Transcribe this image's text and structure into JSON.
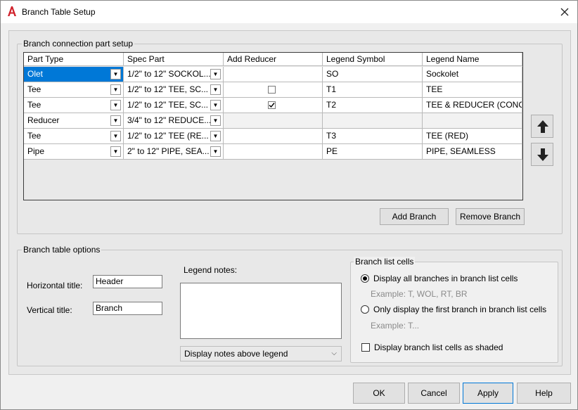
{
  "window": {
    "title": "Branch Table Setup",
    "close_glyph": "✕"
  },
  "connection_group": {
    "legend": "Branch connection part setup",
    "columns": [
      "Part Type",
      "Spec Part",
      "Add Reducer",
      "Legend Symbol",
      "Legend Name"
    ],
    "rows": [
      {
        "part_type": "Olet",
        "spec_part": "1/2\" to 12\"  SOCKOL...",
        "add_reducer": null,
        "legend_symbol": "SO",
        "legend_name": "Sockolet"
      },
      {
        "part_type": "Tee",
        "spec_part": "1/2\" to 12\"  TEE, SC...",
        "add_reducer": false,
        "legend_symbol": "T1",
        "legend_name": "TEE"
      },
      {
        "part_type": "Tee",
        "spec_part": "1/2\" to 12\"  TEE, SC...",
        "add_reducer": true,
        "legend_symbol": "T2",
        "legend_name": "TEE & REDUCER (CONC)"
      },
      {
        "part_type": "Reducer",
        "spec_part": "3/4\" to 12\"  REDUCE...",
        "add_reducer": null,
        "legend_symbol": "",
        "legend_name": ""
      },
      {
        "part_type": "Tee",
        "spec_part": "1/2\" to 12\"  TEE (RE...",
        "add_reducer": null,
        "legend_symbol": "T3",
        "legend_name": "TEE (RED)"
      },
      {
        "part_type": "Pipe",
        "spec_part": "2\" to 12\"  PIPE, SEA...",
        "add_reducer": null,
        "legend_symbol": "PE",
        "legend_name": "PIPE, SEAMLESS"
      }
    ],
    "add_branch": "Add Branch",
    "remove_branch": "Remove Branch"
  },
  "options_group": {
    "legend": "Branch table options",
    "horizontal_title_label": "Horizontal title:",
    "horizontal_title_value": "Header",
    "vertical_title_label": "Vertical title:",
    "vertical_title_value": "Branch",
    "legend_notes_label": "Legend notes:",
    "legend_notes_value": "",
    "notes_position": "Display notes above legend",
    "list_cells": {
      "legend": "Branch list cells",
      "option_all": "Display all branches in branch list cells",
      "example_all": "Example: T, WOL, RT, BR",
      "option_first": "Only display the first branch in branch list cells",
      "example_first": "Example: T...",
      "selected": "all",
      "shaded_label": "Display branch list cells as shaded",
      "shaded": false
    }
  },
  "footer": {
    "ok": "OK",
    "cancel": "Cancel",
    "apply": "Apply",
    "help": "Help"
  },
  "colors": {
    "selection": "#0078d7",
    "brand_icon": "#d0202a"
  }
}
